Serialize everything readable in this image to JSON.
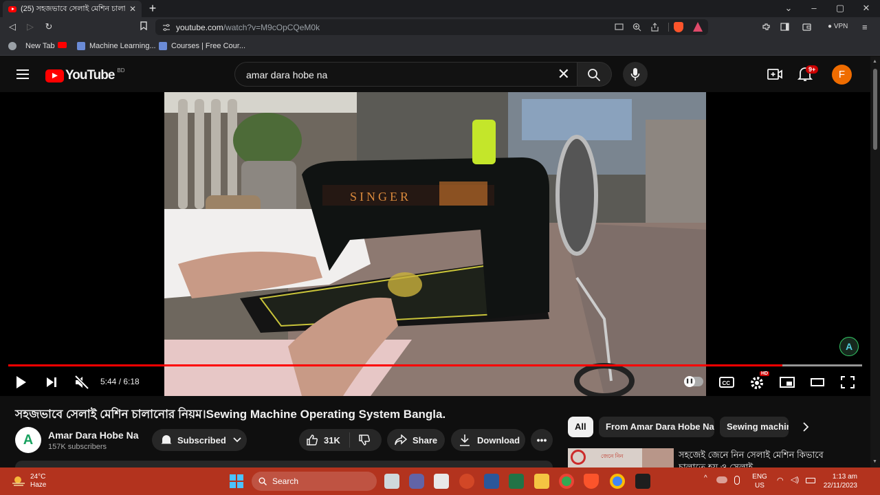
{
  "browser": {
    "tab_title": "(25) সহজভাবে সেলাই মেশিন চালা",
    "url_host": "youtube.com",
    "url_path": "/watch?v=M9cOpCQeM0k",
    "vpn_label": "VPN",
    "bookmarks": [
      {
        "label": "New Tab",
        "icon": "globe-icon"
      },
      {
        "label": "",
        "icon": "youtube-icon"
      },
      {
        "label": "Machine Learning...",
        "icon": "bookmark-site-icon"
      },
      {
        "label": "Courses | Free Cour...",
        "icon": "bookmark-site-icon"
      }
    ]
  },
  "youtube": {
    "country_code": "BD",
    "logo_text": "YouTube",
    "search_query": "amar dara hobe na",
    "notifications_badge": "9+",
    "avatar_letter": "F"
  },
  "player": {
    "current_time": "5:44",
    "duration": "6:18",
    "time_label": "5:44 / 6:18",
    "progress_fraction": 0.907,
    "loaded_fraction": 1.0,
    "settings_badge": "HD",
    "watermark_letter": "A"
  },
  "video": {
    "title": "সহজভাবে সেলাই মেশিন চালানোর নিয়ম।Sewing Machine Operating System Bangla.",
    "channel_name": "Amar Dara Hobe Na",
    "subscribers": "157K subscribers",
    "subscribed_label": "Subscribed",
    "likes": "31K",
    "share_label": "Share",
    "download_label": "Download"
  },
  "chips": [
    "All",
    "From Amar Dara Hobe Na",
    "Sewing machin"
  ],
  "recommendation": {
    "title": "সহজেই জেনে নিন সেলাই মেশিন কিভাবে চালাতে হয় ও সেলাই",
    "thumb_text": "জেনে নিন"
  },
  "taskbar": {
    "temperature": "24°C",
    "weather": "Haze",
    "search_label": "Search",
    "lang_top": "ENG",
    "lang_bottom": "US",
    "time": "1:13 am",
    "date": "22/11/2023"
  },
  "colors": {
    "accent_red": "#ff0000",
    "taskbar": "#b3331e",
    "avatar": "#ef6c00"
  }
}
